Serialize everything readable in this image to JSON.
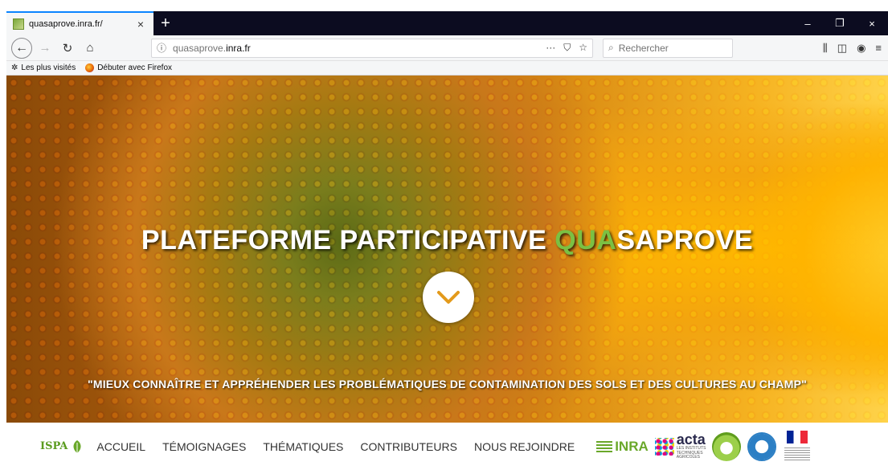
{
  "browser": {
    "tab_title": "quasaprove.inra.fr/",
    "tab_close": "×",
    "new_tab": "+",
    "url_prefix": "quasaprove.",
    "url_domain": "inra.fr",
    "url_more": "···",
    "search_placeholder": "Rechercher",
    "window_controls": {
      "minimize": "–",
      "restore": "❐",
      "close": "×"
    },
    "bookmarks": [
      {
        "label": "Les plus visités",
        "icon": "gear-icon"
      },
      {
        "label": "Débuter avec Firefox",
        "icon": "firefox-icon"
      }
    ]
  },
  "hero": {
    "title_part1": "PLATEFORME PARTICIPATIVE ",
    "title_accent": "QUA",
    "title_part2": "SAPROVE",
    "tagline": "\"MIEUX CONNAÎTRE ET APPRÉHENDER LES PROBLÉMATIQUES DE CONTAMINATION DES SOLS ET DES CULTURES AU CHAMP\""
  },
  "nav": {
    "logo_text": "ISPA",
    "items": [
      "ACCUEIL",
      "TÉMOIGNAGES",
      "THÉMATIQUES",
      "CONTRIBUTEURS",
      "NOUS REJOINDRE"
    ]
  },
  "partners": {
    "inra": "INRA",
    "acta": "acta",
    "acta_sub1": "LES INSTITUTS",
    "acta_sub2": "TECHNIQUES",
    "acta_sub3": "AGRICOLES"
  },
  "colors": {
    "accent_green": "#7bc043",
    "tab_bar": "#0c0c20"
  }
}
